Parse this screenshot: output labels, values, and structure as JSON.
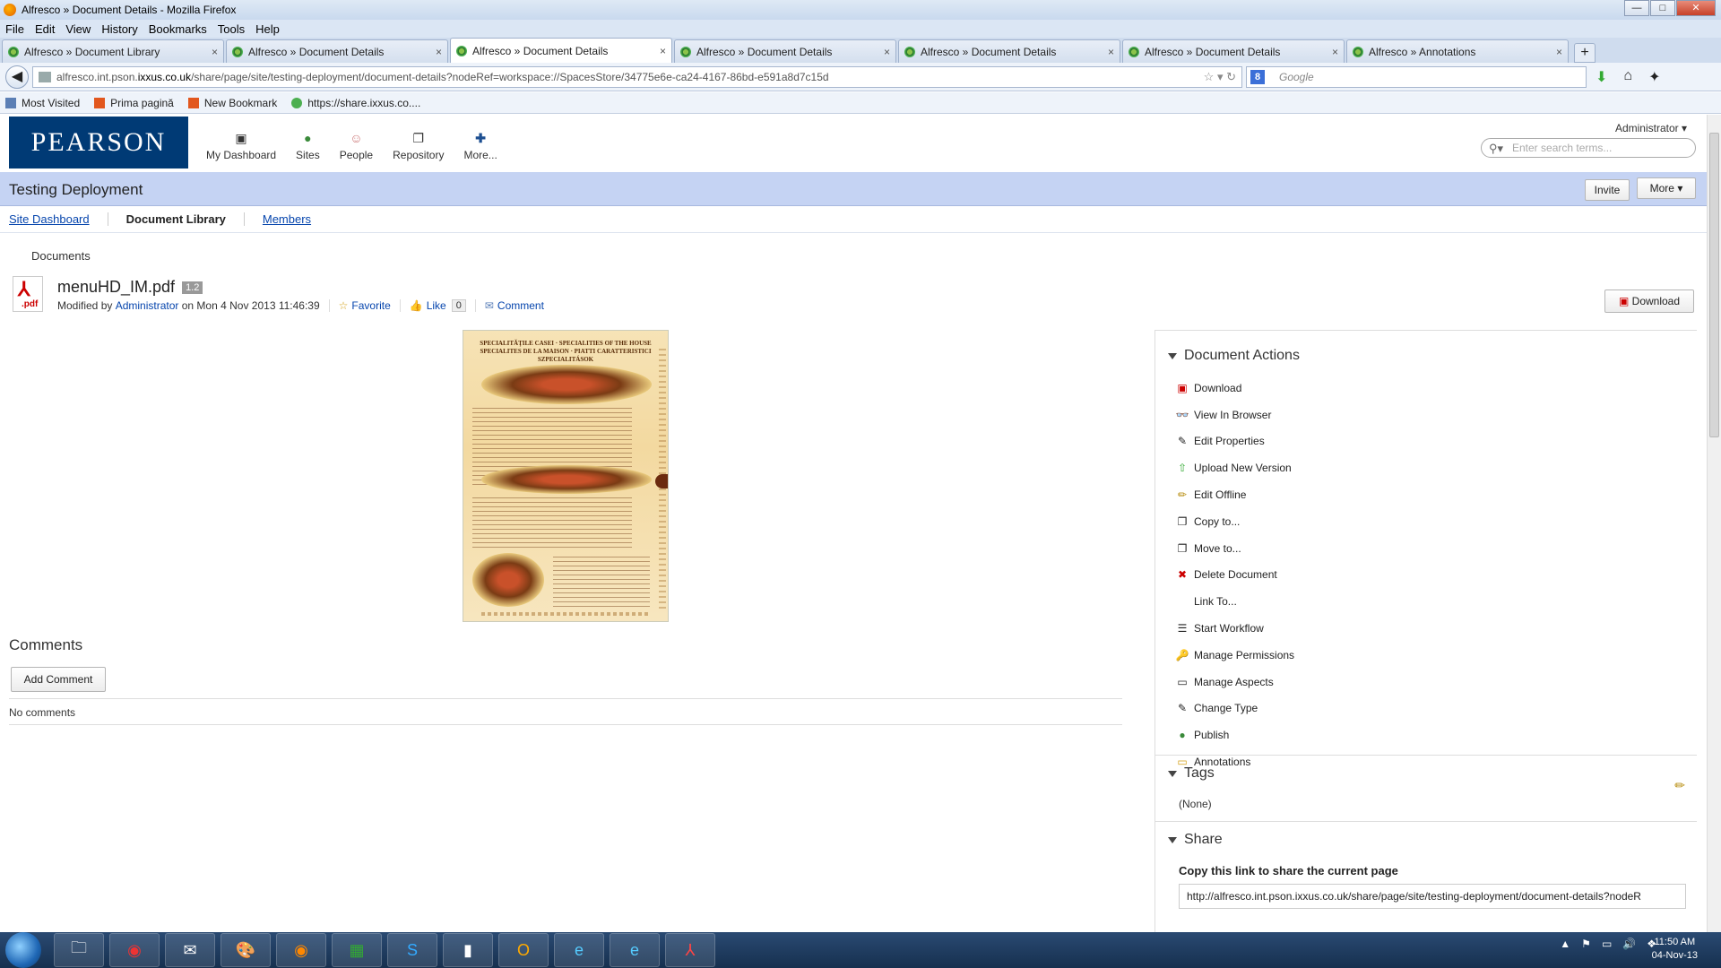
{
  "window": {
    "title": "Alfresco » Document Details - Mozilla Firefox",
    "min_glyph": "—",
    "max_glyph": "□",
    "close_glyph": "✕"
  },
  "menu": [
    "File",
    "Edit",
    "View",
    "History",
    "Bookmarks",
    "Tools",
    "Help"
  ],
  "tabs": [
    {
      "label": "Alfresco » Document Library",
      "active": false
    },
    {
      "label": "Alfresco » Document Details",
      "active": false
    },
    {
      "label": "Alfresco » Document Details",
      "active": true
    },
    {
      "label": "Alfresco » Document Details",
      "active": false
    },
    {
      "label": "Alfresco » Document Details",
      "active": false
    },
    {
      "label": "Alfresco » Document Details",
      "active": false
    },
    {
      "label": "Alfresco » Annotations",
      "active": false
    }
  ],
  "tab_close_glyph": "×",
  "new_tab_glyph": "+",
  "url": {
    "prefix": "alfresco.int.pson.",
    "host": "ixxus.co.uk",
    "path": "/share/page/site/testing-deployment/document-details?nodeRef=workspace://SpacesStore/34775e6e-ca24-4167-86bd-e591a8d7c15d"
  },
  "browser_search": {
    "placeholder": "Google"
  },
  "bookmarks": [
    {
      "label": "Most Visited"
    },
    {
      "label": "Prima pagină"
    },
    {
      "label": "New Bookmark"
    },
    {
      "label": "https://share.ixxus.co...."
    }
  ],
  "header": {
    "logo": "PEARSON",
    "nav": [
      {
        "label": "My Dashboard",
        "icon": "dashboard-icon"
      },
      {
        "label": "Sites",
        "icon": "globe-icon"
      },
      {
        "label": "People",
        "icon": "people-icon"
      },
      {
        "label": "Repository",
        "icon": "repository-icon"
      },
      {
        "label": "More...",
        "icon": "plus-icon"
      }
    ],
    "user": "Administrator",
    "search_placeholder": "Enter search terms..."
  },
  "site": {
    "title": "Testing Deployment",
    "invite_label": "Invite",
    "more_label": "More",
    "subnav": [
      "Site Dashboard",
      "Document Library",
      "Members"
    ],
    "current": "Document Library"
  },
  "document": {
    "breadcrumb": "Documents",
    "icon_ext": ".pdf",
    "name": "menuHD_IM.pdf",
    "version": "1.2",
    "modified_by_label": "Modified by",
    "modified_by": "Administrator",
    "modified_on": "on Mon 4 Nov 2013 11:46:39",
    "favorite_label": "Favorite",
    "like_label": "Like",
    "like_count": "0",
    "comment_label": "Comment",
    "download_label": "Download",
    "preview": {
      "heading_line1": "SPECIALITĂŢILE CASEI · SPECIALITIES OF THE HOUSE",
      "heading_line2": "SPECIALITES DE LA MAISON · PIATTI CARATTERISTICI",
      "heading_line3": "SZPECIALITÁSOK"
    }
  },
  "comments": {
    "title": "Comments",
    "add_label": "Add Comment",
    "empty_text": "No comments"
  },
  "document_actions": {
    "title": "Document Actions",
    "items": [
      {
        "label": "Download",
        "icon": "download-icon"
      },
      {
        "label": "View In Browser",
        "icon": "view-browser-icon"
      },
      {
        "label": "Edit Properties",
        "icon": "edit-properties-icon"
      },
      {
        "label": "Upload New Version",
        "icon": "upload-icon"
      },
      {
        "label": "Edit Offline",
        "icon": "pencil-icon"
      },
      {
        "label": "Copy to...",
        "icon": "copy-icon"
      },
      {
        "label": "Move to...",
        "icon": "move-icon"
      },
      {
        "label": "Delete Document",
        "icon": "delete-icon"
      },
      {
        "label": "Link To...",
        "icon": ""
      },
      {
        "label": "Start Workflow",
        "icon": "workflow-icon"
      },
      {
        "label": "Manage Permissions",
        "icon": "permissions-icon"
      },
      {
        "label": "Manage Aspects",
        "icon": "aspects-icon"
      },
      {
        "label": "Change Type",
        "icon": "change-type-icon"
      },
      {
        "label": "Publish",
        "icon": "publish-icon"
      },
      {
        "label": "Annotations",
        "icon": "annotations-icon"
      }
    ]
  },
  "tags": {
    "title": "Tags",
    "value": "(None)"
  },
  "share": {
    "title": "Share",
    "label": "Copy this link to share the current page",
    "link": "http://alfresco.int.pson.ixxus.co.uk/share/page/site/testing-deployment/document-details?nodeR"
  },
  "taskbar": {
    "apps": [
      "explorer",
      "chrome",
      "outlook-express",
      "paint",
      "firefox",
      "calc",
      "skype",
      "cmd",
      "outlook",
      "ie",
      "ie",
      "acrobat"
    ],
    "time": "11:50 AM",
    "date": "04-Nov-13"
  },
  "colors": {
    "brand": "#003a75",
    "sitebar": "#c5d3f3",
    "link": "#0645ad"
  }
}
